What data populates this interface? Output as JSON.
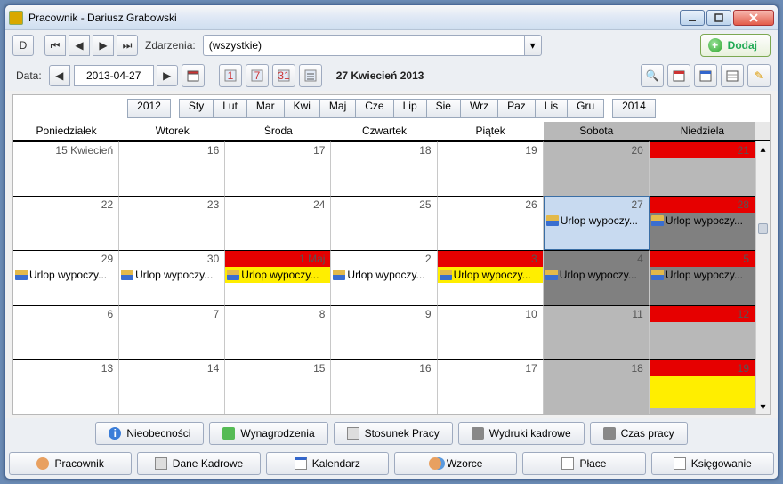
{
  "window": {
    "title": "Pracownik - Dariusz Grabowski"
  },
  "toolbar1": {
    "d_label": "D",
    "events_label": "Zdarzenia:",
    "events_value": "(wszystkie)",
    "dodaj_label": "Dodaj"
  },
  "toolbar2": {
    "date_label": "Data:",
    "date_value": "2013-04-27",
    "month_title": "27 Kwiecień 2013"
  },
  "year_bar": {
    "prev_year": "2012",
    "months": [
      "Sty",
      "Lut",
      "Mar",
      "Kwi",
      "Maj",
      "Cze",
      "Lip",
      "Sie",
      "Wrz",
      "Paz",
      "Lis",
      "Gru"
    ],
    "next_year": "2014"
  },
  "days_header": [
    "Poniedziałek",
    "Wtorek",
    "Środa",
    "Czwartek",
    "Piątek",
    "Sobota",
    "Niedziela"
  ],
  "calendar": {
    "rows": [
      [
        {
          "label": "15 Kwiecień"
        },
        {
          "label": "16"
        },
        {
          "label": "17"
        },
        {
          "label": "18"
        },
        {
          "label": "19"
        },
        {
          "label": "20",
          "weekend": true
        },
        {
          "label": "21",
          "weekend": true,
          "red_band": true
        }
      ],
      [
        {
          "label": "22"
        },
        {
          "label": "23"
        },
        {
          "label": "24"
        },
        {
          "label": "25"
        },
        {
          "label": "26"
        },
        {
          "label": "27",
          "weekend": true,
          "selected": true,
          "event": "Urlop wypoczy..."
        },
        {
          "label": "28",
          "weekend": true,
          "red_band": true,
          "dark": true,
          "event": "Urlop wypoczy..."
        }
      ],
      [
        {
          "label": "29",
          "event": "Urlop wypoczy..."
        },
        {
          "label": "30",
          "event": "Urlop wypoczy..."
        },
        {
          "label": "1 Maj",
          "red_band": true,
          "event": "Urlop wypoczy...",
          "event_yellow": true
        },
        {
          "label": "2",
          "event": "Urlop wypoczy..."
        },
        {
          "label": "3",
          "red_band": true,
          "event": "Urlop wypoczy...",
          "event_yellow": true
        },
        {
          "label": "4",
          "weekend": true,
          "dark": true,
          "event": "Urlop wypoczy..."
        },
        {
          "label": "5",
          "weekend": true,
          "red_band": true,
          "dark": true,
          "event": "Urlop wypoczy..."
        }
      ],
      [
        {
          "label": "6"
        },
        {
          "label": "7"
        },
        {
          "label": "8"
        },
        {
          "label": "9"
        },
        {
          "label": "10"
        },
        {
          "label": "11",
          "weekend": true
        },
        {
          "label": "12",
          "weekend": true,
          "red_band": true
        }
      ],
      [
        {
          "label": "13"
        },
        {
          "label": "14"
        },
        {
          "label": "15"
        },
        {
          "label": "16"
        },
        {
          "label": "17"
        },
        {
          "label": "18",
          "weekend": true
        },
        {
          "label": "19",
          "weekend": true,
          "red_band": true,
          "yellow_fill": true
        }
      ]
    ]
  },
  "mid_tabs": [
    "Nieobecności",
    "Wynagrodzenia",
    "Stosunek Pracy",
    "Wydruki kadrowe",
    "Czas pracy"
  ],
  "bottom_tabs": [
    "Pracownik",
    "Dane Kadrowe",
    "Kalendarz",
    "Wzorce",
    "Płace",
    "Księgowanie"
  ],
  "icons": {
    "first": "|◀",
    "prev": "◀",
    "next": "▶",
    "last": "▶|",
    "dropdown": "▾",
    "search": "🔍",
    "pencil": "✎"
  }
}
